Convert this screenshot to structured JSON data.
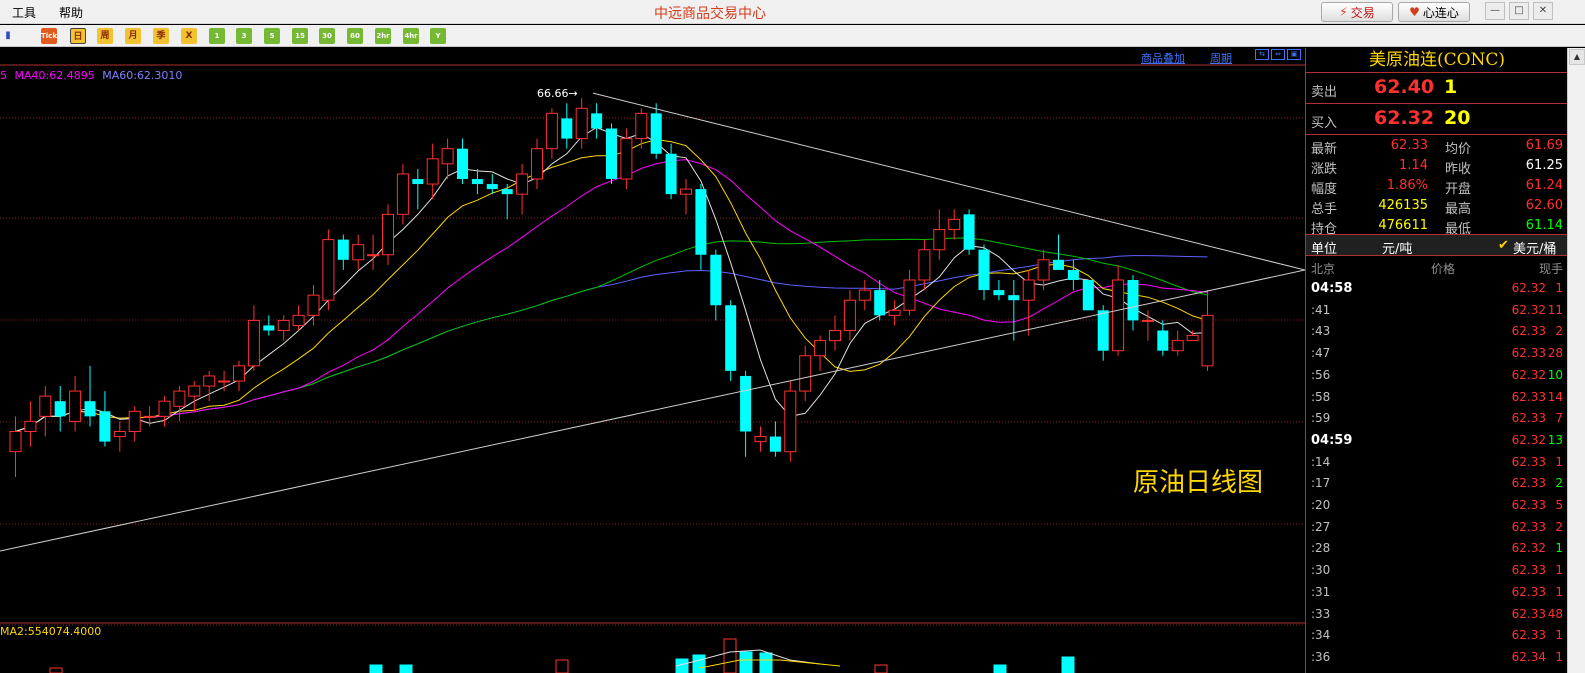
{
  "menu": {
    "tools": "工具",
    "help": "帮助"
  },
  "app_title": "中远商品交易中心",
  "top_buttons": {
    "trade": "交易",
    "heart": "心连心"
  },
  "toolbar": {
    "buttons": [
      {
        "name": "kline-icon",
        "label": ""
      },
      {
        "name": "tick-icon",
        "label": "Tick"
      },
      {
        "name": "daily-button",
        "label": "日"
      },
      {
        "name": "weekly-button",
        "label": "周"
      },
      {
        "name": "monthly-button",
        "label": "月"
      },
      {
        "name": "quarterly-button",
        "label": "季"
      },
      {
        "name": "cross-icon",
        "label": "X"
      },
      {
        "name": "min1-button",
        "label": "1"
      },
      {
        "name": "min3-button",
        "label": "3"
      },
      {
        "name": "min5-button",
        "label": "5"
      },
      {
        "name": "min15-button",
        "label": "15"
      },
      {
        "name": "min30-button",
        "label": "30"
      },
      {
        "name": "min60-button",
        "label": "60"
      },
      {
        "name": "hr2-button",
        "label": "2hr"
      },
      {
        "name": "hr4-button",
        "label": "4hr"
      },
      {
        "name": "year-button",
        "label": "Y"
      }
    ]
  },
  "chart": {
    "overlay_link": "商品叠加",
    "period_link": "周期",
    "ma_legend": [
      {
        "text": "5",
        "color": "#ff00ff"
      },
      {
        "text": "MA40:62.4895",
        "color": "#ff00ff"
      },
      {
        "text": "MA60:62.3010",
        "color": "#8080ff"
      }
    ],
    "peak_label": "66.66",
    "caption": "原油日线图",
    "volume_legend": "MA2:554074.4000"
  },
  "chart_data": {
    "type": "candlestick",
    "title": "原油日线图",
    "series_colors": {
      "up": "#ff3030",
      "down": "#00ffff"
    },
    "candles": [
      {
        "o": 59.6,
        "h": 60.3,
        "l": 59.1,
        "c": 60.0
      },
      {
        "o": 60.0,
        "h": 60.6,
        "l": 59.7,
        "c": 60.2
      },
      {
        "o": 60.3,
        "h": 60.9,
        "l": 59.9,
        "c": 60.7
      },
      {
        "o": 60.6,
        "h": 60.9,
        "l": 60.0,
        "c": 60.3
      },
      {
        "o": 60.2,
        "h": 61.1,
        "l": 60.0,
        "c": 60.8
      },
      {
        "o": 60.6,
        "h": 61.3,
        "l": 60.1,
        "c": 60.3
      },
      {
        "o": 60.4,
        "h": 60.8,
        "l": 59.7,
        "c": 59.8
      },
      {
        "o": 59.9,
        "h": 60.2,
        "l": 59.6,
        "c": 60.0
      },
      {
        "o": 60.0,
        "h": 60.5,
        "l": 59.8,
        "c": 60.4
      },
      {
        "o": 60.3,
        "h": 60.5,
        "l": 60.1,
        "c": 60.3
      },
      {
        "o": 60.3,
        "h": 60.7,
        "l": 60.1,
        "c": 60.6
      },
      {
        "o": 60.5,
        "h": 60.9,
        "l": 60.2,
        "c": 60.8
      },
      {
        "o": 60.7,
        "h": 61.0,
        "l": 60.4,
        "c": 60.9
      },
      {
        "o": 60.9,
        "h": 61.2,
        "l": 60.6,
        "c": 61.1
      },
      {
        "o": 61.0,
        "h": 61.2,
        "l": 60.8,
        "c": 61.0
      },
      {
        "o": 61.0,
        "h": 61.4,
        "l": 60.8,
        "c": 61.3
      },
      {
        "o": 61.3,
        "h": 62.5,
        "l": 61.2,
        "c": 62.2
      },
      {
        "o": 62.1,
        "h": 62.3,
        "l": 61.9,
        "c": 62.0
      },
      {
        "o": 62.0,
        "h": 62.3,
        "l": 61.8,
        "c": 62.2
      },
      {
        "o": 62.1,
        "h": 62.5,
        "l": 62.0,
        "c": 62.3
      },
      {
        "o": 62.3,
        "h": 62.9,
        "l": 62.1,
        "c": 62.7
      },
      {
        "o": 62.6,
        "h": 64.0,
        "l": 62.4,
        "c": 63.8
      },
      {
        "o": 63.8,
        "h": 63.9,
        "l": 63.2,
        "c": 63.4
      },
      {
        "o": 63.4,
        "h": 63.9,
        "l": 63.2,
        "c": 63.7
      },
      {
        "o": 63.5,
        "h": 63.9,
        "l": 63.2,
        "c": 63.5
      },
      {
        "o": 63.5,
        "h": 64.5,
        "l": 63.3,
        "c": 64.3
      },
      {
        "o": 64.3,
        "h": 65.3,
        "l": 64.1,
        "c": 65.1
      },
      {
        "o": 65.0,
        "h": 65.2,
        "l": 64.4,
        "c": 64.9
      },
      {
        "o": 64.9,
        "h": 65.7,
        "l": 64.6,
        "c": 65.4
      },
      {
        "o": 65.3,
        "h": 65.8,
        "l": 65.0,
        "c": 65.6
      },
      {
        "o": 65.6,
        "h": 65.8,
        "l": 64.9,
        "c": 65.0
      },
      {
        "o": 65.0,
        "h": 65.2,
        "l": 64.7,
        "c": 64.9
      },
      {
        "o": 64.9,
        "h": 65.1,
        "l": 64.7,
        "c": 64.8
      },
      {
        "o": 64.8,
        "h": 64.9,
        "l": 64.2,
        "c": 64.7
      },
      {
        "o": 64.7,
        "h": 65.3,
        "l": 64.3,
        "c": 65.1
      },
      {
        "o": 65.0,
        "h": 65.8,
        "l": 64.8,
        "c": 65.6
      },
      {
        "o": 65.6,
        "h": 66.4,
        "l": 65.4,
        "c": 66.3
      },
      {
        "o": 66.2,
        "h": 66.5,
        "l": 65.6,
        "c": 65.8
      },
      {
        "o": 65.8,
        "h": 66.6,
        "l": 65.6,
        "c": 66.4
      },
      {
        "o": 66.3,
        "h": 66.5,
        "l": 65.8,
        "c": 66.0
      },
      {
        "o": 66.0,
        "h": 66.1,
        "l": 64.9,
        "c": 65.0
      },
      {
        "o": 65.0,
        "h": 66.0,
        "l": 64.8,
        "c": 65.8
      },
      {
        "o": 65.8,
        "h": 66.4,
        "l": 65.6,
        "c": 66.3
      },
      {
        "o": 66.3,
        "h": 66.5,
        "l": 65.4,
        "c": 65.5
      },
      {
        "o": 65.5,
        "h": 65.7,
        "l": 64.6,
        "c": 64.7
      },
      {
        "o": 64.7,
        "h": 65.0,
        "l": 64.3,
        "c": 64.8
      },
      {
        "o": 64.8,
        "h": 64.9,
        "l": 63.2,
        "c": 63.5
      },
      {
        "o": 63.5,
        "h": 63.6,
        "l": 62.2,
        "c": 62.5
      },
      {
        "o": 62.5,
        "h": 62.6,
        "l": 61.0,
        "c": 61.2
      },
      {
        "o": 61.1,
        "h": 61.2,
        "l": 59.5,
        "c": 60.0
      },
      {
        "o": 59.8,
        "h": 60.1,
        "l": 59.6,
        "c": 59.9
      },
      {
        "o": 59.9,
        "h": 60.2,
        "l": 59.5,
        "c": 59.6
      },
      {
        "o": 59.6,
        "h": 61.0,
        "l": 59.4,
        "c": 60.8
      },
      {
        "o": 60.8,
        "h": 61.7,
        "l": 60.6,
        "c": 61.5
      },
      {
        "o": 61.5,
        "h": 61.9,
        "l": 61.2,
        "c": 61.8
      },
      {
        "o": 61.8,
        "h": 62.3,
        "l": 61.6,
        "c": 62.0
      },
      {
        "o": 62.0,
        "h": 62.8,
        "l": 61.8,
        "c": 62.6
      },
      {
        "o": 62.6,
        "h": 63.0,
        "l": 62.4,
        "c": 62.8
      },
      {
        "o": 62.8,
        "h": 63.0,
        "l": 62.2,
        "c": 62.3
      },
      {
        "o": 62.3,
        "h": 62.6,
        "l": 62.1,
        "c": 62.4
      },
      {
        "o": 62.4,
        "h": 63.2,
        "l": 62.3,
        "c": 63.0
      },
      {
        "o": 63.0,
        "h": 63.8,
        "l": 62.8,
        "c": 63.6
      },
      {
        "o": 63.6,
        "h": 64.4,
        "l": 63.4,
        "c": 64.0
      },
      {
        "o": 64.0,
        "h": 64.4,
        "l": 63.8,
        "c": 64.2
      },
      {
        "o": 64.3,
        "h": 64.4,
        "l": 63.5,
        "c": 63.6
      },
      {
        "o": 63.6,
        "h": 63.7,
        "l": 62.6,
        "c": 62.8
      },
      {
        "o": 62.8,
        "h": 63.0,
        "l": 62.6,
        "c": 62.7
      },
      {
        "o": 62.7,
        "h": 63.0,
        "l": 61.8,
        "c": 62.6
      },
      {
        "o": 62.6,
        "h": 63.2,
        "l": 61.9,
        "c": 63.0
      },
      {
        "o": 63.0,
        "h": 63.6,
        "l": 62.8,
        "c": 63.4
      },
      {
        "o": 63.4,
        "h": 63.9,
        "l": 63.2,
        "c": 63.2
      },
      {
        "o": 63.2,
        "h": 63.4,
        "l": 62.8,
        "c": 63.0
      },
      {
        "o": 63.0,
        "h": 63.0,
        "l": 62.4,
        "c": 62.4
      },
      {
        "o": 62.4,
        "h": 62.5,
        "l": 61.4,
        "c": 61.6
      },
      {
        "o": 61.6,
        "h": 63.3,
        "l": 61.5,
        "c": 63.0
      },
      {
        "o": 63.0,
        "h": 63.1,
        "l": 62.0,
        "c": 62.2
      },
      {
        "o": 62.2,
        "h": 62.4,
        "l": 61.8,
        "c": 62.2
      },
      {
        "o": 62.0,
        "h": 62.2,
        "l": 61.5,
        "c": 61.6
      },
      {
        "o": 61.6,
        "h": 62.0,
        "l": 61.5,
        "c": 61.8
      },
      {
        "o": 61.8,
        "h": 62.0,
        "l": 61.8,
        "c": 61.9
      },
      {
        "o": 61.3,
        "h": 62.8,
        "l": 61.2,
        "c": 62.3
      }
    ],
    "trendlines": [
      "upper-resistance",
      "lower-support"
    ],
    "ma_lines": [
      "MA5",
      "MA10",
      "MA20",
      "MA40",
      "MA60"
    ]
  },
  "panel": {
    "instrument": "美原油连(CONC)",
    "ask": {
      "label": "卖出",
      "price": "62.40",
      "volume": "1"
    },
    "bid": {
      "label": "买入",
      "price": "62.32",
      "volume": "20"
    },
    "stats": [
      {
        "l1": "最新",
        "v1": "62.33",
        "c1": "red",
        "l2": "均价",
        "v2": "61.69",
        "c2": "red"
      },
      {
        "l1": "涨跌",
        "v1": "1.14",
        "c1": "red",
        "l2": "昨收",
        "v2": "61.25",
        "c2": "white"
      },
      {
        "l1": "幅度",
        "v1": "1.86%",
        "c1": "red",
        "l2": "开盘",
        "v2": "61.24",
        "c2": "red"
      },
      {
        "l1": "总手",
        "v1": "426135",
        "c1": "yellow",
        "l2": "最高",
        "v2": "62.60",
        "c2": "red"
      },
      {
        "l1": "持仓",
        "v1": "476611",
        "c1": "yellow",
        "l2": "最低",
        "v2": "61.14",
        "c2": "green"
      }
    ],
    "unit": {
      "label": "单位",
      "value": "元/吨",
      "option": "美元/桶"
    },
    "tick_header": {
      "place": "北京",
      "price": "价格",
      "qty": "现手"
    },
    "ticks": [
      {
        "t": "04:58",
        "bold": true,
        "p": "62.32",
        "q": "1",
        "qc": "red"
      },
      {
        "t": ":41",
        "p": "62.32",
        "q": "11",
        "qc": "red"
      },
      {
        "t": ":43",
        "p": "62.33",
        "q": "2",
        "qc": "red"
      },
      {
        "t": ":47",
        "p": "62.33",
        "q": "28",
        "qc": "red"
      },
      {
        "t": ":56",
        "p": "62.32",
        "q": "10",
        "qc": "green"
      },
      {
        "t": ":58",
        "p": "62.33",
        "q": "14",
        "qc": "red"
      },
      {
        "t": ":59",
        "p": "62.33",
        "q": "7",
        "qc": "red"
      },
      {
        "t": "04:59",
        "bold": true,
        "p": "62.32",
        "q": "13",
        "qc": "green"
      },
      {
        "t": ":14",
        "p": "62.33",
        "q": "1",
        "qc": "red"
      },
      {
        "t": ":17",
        "p": "62.33",
        "q": "2",
        "qc": "green"
      },
      {
        "t": ":20",
        "p": "62.33",
        "q": "5",
        "qc": "red"
      },
      {
        "t": ":27",
        "p": "62.33",
        "q": "2",
        "qc": "red"
      },
      {
        "t": ":28",
        "p": "62.32",
        "q": "1",
        "qc": "green"
      },
      {
        "t": ":30",
        "p": "62.33",
        "q": "1",
        "qc": "red"
      },
      {
        "t": ":31",
        "p": "62.33",
        "q": "1",
        "qc": "red"
      },
      {
        "t": ":33",
        "p": "62.33",
        "q": "48",
        "qc": "red"
      },
      {
        "t": ":34",
        "p": "62.33",
        "q": "1",
        "qc": "red"
      },
      {
        "t": ":36",
        "p": "62.34",
        "q": "1",
        "qc": "red"
      }
    ]
  }
}
